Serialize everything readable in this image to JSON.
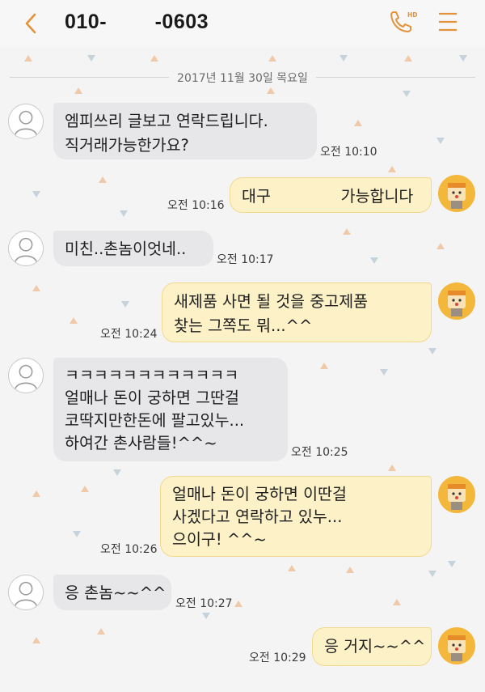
{
  "header": {
    "title": "010-        -0603",
    "call_badge": "HD",
    "icons": [
      "back-arrow-icon",
      "phone-hd-icon",
      "menu-icon"
    ],
    "accent_color": "#e2933b"
  },
  "date_divider": "2017년 11월 30일 목요일",
  "messages": [
    {
      "side": "in",
      "text": "엠피쓰리 글보고 연락드립니다.\n직거래가능한가요?",
      "time": "오전 10:10"
    },
    {
      "side": "out",
      "text": "대구              가능합니다",
      "time": "오전 10:16"
    },
    {
      "side": "in",
      "text": "미친..촌놈이엇네..",
      "time": "오전 10:17"
    },
    {
      "side": "out",
      "text": "새제품 사면 될 것을 중고제품\n찾는 그쪽도 뭐...^^",
      "time": "오전 10:24"
    },
    {
      "side": "in",
      "text": "ㅋㅋㅋㅋㅋㅋㅋㅋㅋㅋㅋㅋ\n얼매나 돈이 궁하면 그딴걸\n코딱지만한돈에 팔고있누...\n하여간 촌사람들!^^~",
      "time": "오전 10:25"
    },
    {
      "side": "out",
      "text": "얼매나 돈이 궁하면 이딴걸\n사겠다고 연락하고 있누...\n으이구! ^^~",
      "time": "오전 10:26"
    },
    {
      "side": "in",
      "text": "응 촌놈~~^^",
      "time": "오전 10:27"
    },
    {
      "side": "out",
      "text": "응 거지~~^^",
      "time": "오전 10:29"
    }
  ]
}
